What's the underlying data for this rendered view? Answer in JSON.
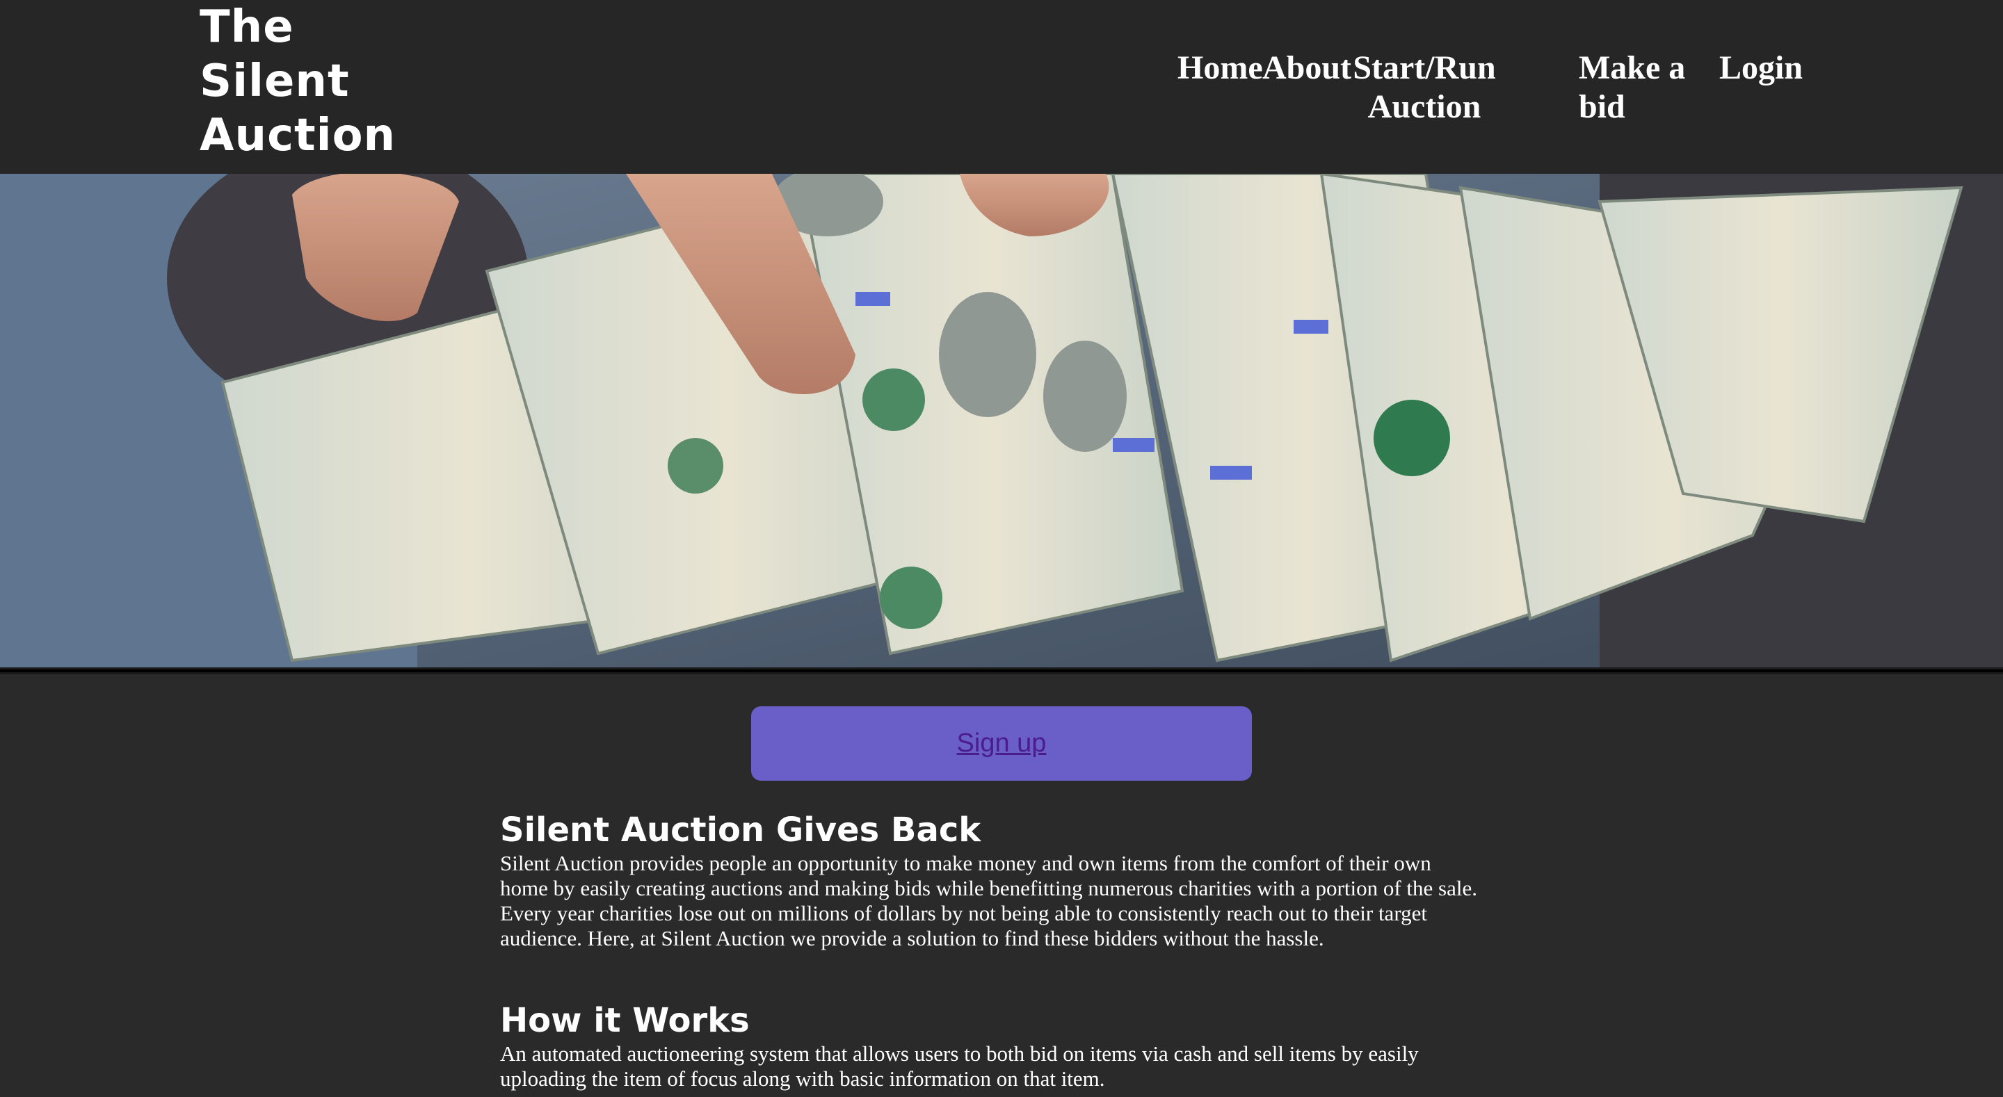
{
  "brand": {
    "name_line1": "The",
    "name_line2": "Silent",
    "name_line3": "Auction"
  },
  "nav": {
    "home": "Home",
    "about": "About",
    "start_run_line1": "Start/Run",
    "start_run_line2": "Auction",
    "make_bid_line1": "Make a",
    "make_bid_line2": "bid",
    "login": "Login"
  },
  "hero": {
    "image": "hand-fanning-hundred-dollar-bills"
  },
  "signup": {
    "label": "Sign up"
  },
  "sections": [
    {
      "title": "Silent Auction Gives Back",
      "body": "Silent Auction provides people an opportunity to make money and own items from the comfort of their own home by easily creating auctions and making bids while benefitting numerous charities with a portion of the sale. Every year charities lose out on millions of dollars by not being able to consistently reach out to their target audience. Here, at Silent Auction we provide a solution to find these bidders without the hassle."
    },
    {
      "title": "How it Works",
      "body": "An automated auctioneering system that allows users to both bid on items via cash and sell items by easily uploading the item of focus along with basic information on that item."
    }
  ],
  "colors": {
    "header_bg": "#262626",
    "page_bg": "#2a2a2a",
    "signup_bg": "#6a5ec9",
    "signup_link": "#4b1d8c",
    "text": "#ffffff"
  }
}
